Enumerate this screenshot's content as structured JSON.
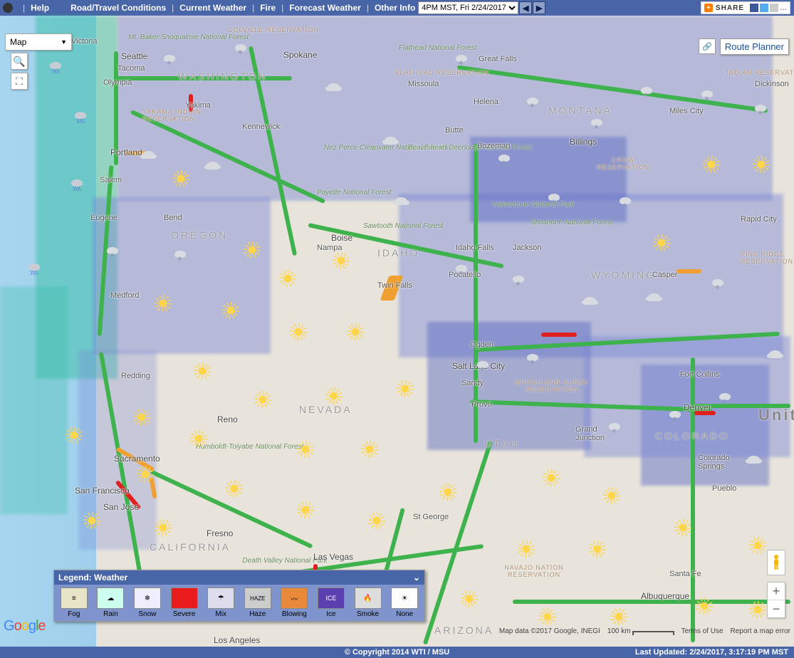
{
  "topbar": {
    "help": "Help",
    "road": "Road/Travel Conditions",
    "current": "Current Weather",
    "fire": "Fire",
    "forecast": "Forecast Weather",
    "other": "Other Info",
    "time_selected": "4PM MST, Fri 2/24/2017",
    "share": "SHARE"
  },
  "controls": {
    "maptype": "Map",
    "route_planner": "Route Planner"
  },
  "legend": {
    "title": "Legend: Weather",
    "items": [
      "Fog",
      "Rain",
      "Snow",
      "Severe",
      "Mix",
      "Haze",
      "Blowing",
      "Ice",
      "Smoke",
      "None"
    ]
  },
  "attribution": {
    "mapdata": "Map data ©2017 Google, INEGI",
    "scale": "100 km",
    "terms": "Terms of Use",
    "report": "Report a map error"
  },
  "footer": {
    "copyright": "© Copyright 2014 WTI / MSU",
    "updated": "Last Updated: 2/24/2017, 3:17:19 PM MST"
  },
  "labels": {
    "states": {
      "WASHINGTON": "WASHINGTON",
      "OREGON": "OREGON",
      "IDAHO": "IDAHO",
      "MONTANA": "MONTANA",
      "WYOMING": "WYOMING",
      "NEVADA": "NEVADA",
      "UTAH": "UTAH",
      "COLORADO": "COLORADO",
      "CALIFORNIA": "CALIFORNIA",
      "ARIZONA": "ARIZONA",
      "Unit": "Unit"
    },
    "cities": {
      "Victoria": "Victoria",
      "Seattle": "Seattle",
      "Tacoma": "Tacoma",
      "Olympia": "Olympia",
      "Spokane": "Spokane",
      "Missoula": "Missoula",
      "GreatFalls": "Great Falls",
      "Helena": "Helena",
      "Bozeman": "Bozeman",
      "Butte": "Butte",
      "Billings": "Billings",
      "MilesCity": "Miles City",
      "Dickinson": "Dickinson",
      "Portland": "Portland",
      "Salem": "Salem",
      "Eugene": "Eugene",
      "Bend": "Bend",
      "Medford": "Medford",
      "Kennewick": "Kennewick",
      "Yakima": "Yakima",
      "Boise": "Boise",
      "Nampa": "Nampa",
      "TwinFalls": "Twin Falls",
      "Pocatello": "Pocatello",
      "IdahoFalls": "Idaho Falls",
      "Jackson": "Jackson",
      "Casper": "Casper",
      "RapidCity": "Rapid City",
      "Redding": "Redding",
      "Reno": "Reno",
      "Sacramento": "Sacramento",
      "SanFrancisco": "San Francisco",
      "SanJose": "San Jose",
      "Fresno": "Fresno",
      "LosAngeles": "Los Angeles",
      "LasVegas": "Las Vegas",
      "StGeorge": "St George",
      "Ogden": "Ogden",
      "SLC": "Salt Lake City",
      "Sandy": "Sandy",
      "Provo": "Provo",
      "GrandJunction": "Grand Junction",
      "Denver": "Denver",
      "FortCollins": "Fort Collins",
      "ColoradoSprings": "Colorado Springs",
      "Pueblo": "Pueblo",
      "Albuquerque": "Albuquerque",
      "SantaFe": "Santa Fe"
    },
    "forests": {
      "Snoqualmie": "Mt. Baker-Snoqualmie National Forest",
      "Flathead": "Flathead National Forest",
      "NezPerce": "Nez Perce-Clearwater National Forests",
      "Beaverhead": "Beaverhead-Deerlodge National Forest",
      "Payette": "Payette National Forest",
      "Sawtooth": "Sawtooth National Forest",
      "Yellowstone": "Yellowstone National Park",
      "Shoshone": "Shoshone National Forest",
      "Humboldt": "Humboldt-Toiyabe National Forest",
      "DeathValley": "Death Valley National Park"
    },
    "reservations": {
      "Colville": "COLVILLE RESERVATION",
      "Yakama": "YAKAMA INDIAN RESERVATION",
      "Flathead": "FLATHEAD RESERVATION",
      "Indian": "INDIAN RESERVATION",
      "Crow": "CROW RESERVATION",
      "PineRidge": "PINE RIDGE RESERVATION",
      "Uintah": "UINTAH AND OURAY RESERVATION",
      "Navajo": "NAVAJO NATION RESERVATION"
    }
  }
}
